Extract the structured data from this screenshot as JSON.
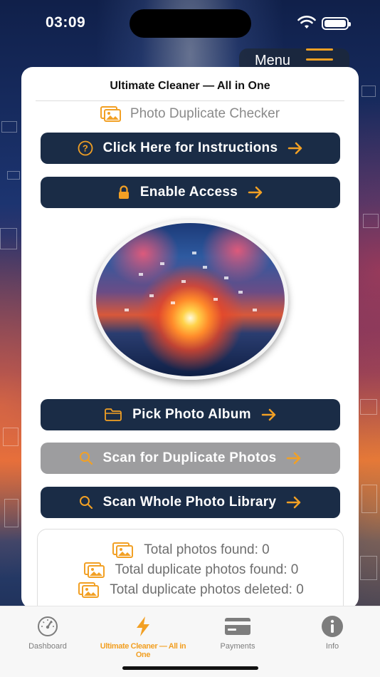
{
  "status_bar": {
    "time": "03:09"
  },
  "menu": {
    "label": "Menu"
  },
  "card": {
    "title": "Ultimate Cleaner — All in One",
    "subtitle": "Photo Duplicate Checker"
  },
  "buttons": {
    "instructions": "Click Here for Instructions",
    "enable_access": "Enable Access",
    "pick_album": "Pick Photo Album",
    "scan_duplicates": "Scan for Duplicate Photos",
    "scan_library": "Scan Whole Photo Library"
  },
  "stats": {
    "total_found": "Total photos found: 0",
    "duplicates_found": "Total duplicate photos found: 0",
    "duplicates_deleted": "Total duplicate photos deleted: 0"
  },
  "tabs": [
    {
      "label": "Dashboard",
      "icon": "gauge-icon"
    },
    {
      "label": "Ultimate Cleaner — All in One",
      "icon": "bolt-icon"
    },
    {
      "label": "Payments",
      "icon": "credit-card-icon"
    },
    {
      "label": "Info",
      "icon": "info-icon"
    }
  ],
  "colors": {
    "accent": "#f2a024",
    "button_bg": "#1a2c46",
    "button_disabled": "#9d9d9f",
    "tab_inactive": "#7d7d7d"
  }
}
